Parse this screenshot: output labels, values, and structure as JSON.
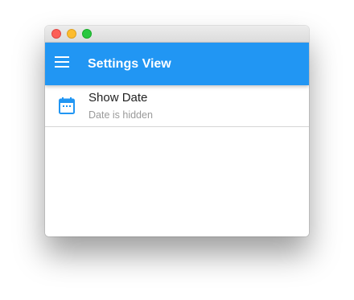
{
  "window": {
    "controls": [
      "close",
      "minimize",
      "maximize"
    ],
    "control_colors": {
      "close": "#fc5f57",
      "minimize": "#fdbc2e",
      "maximize": "#28c840"
    }
  },
  "appbar": {
    "title": "Settings View",
    "menu_icon": "menu-icon",
    "color": "#2196f3"
  },
  "settings": {
    "items": [
      {
        "icon": "calendar-icon",
        "title": "Show Date",
        "subtitle": "Date is hidden"
      }
    ]
  },
  "colors": {
    "accent": "#2196f3",
    "icon": "#2196f3"
  }
}
